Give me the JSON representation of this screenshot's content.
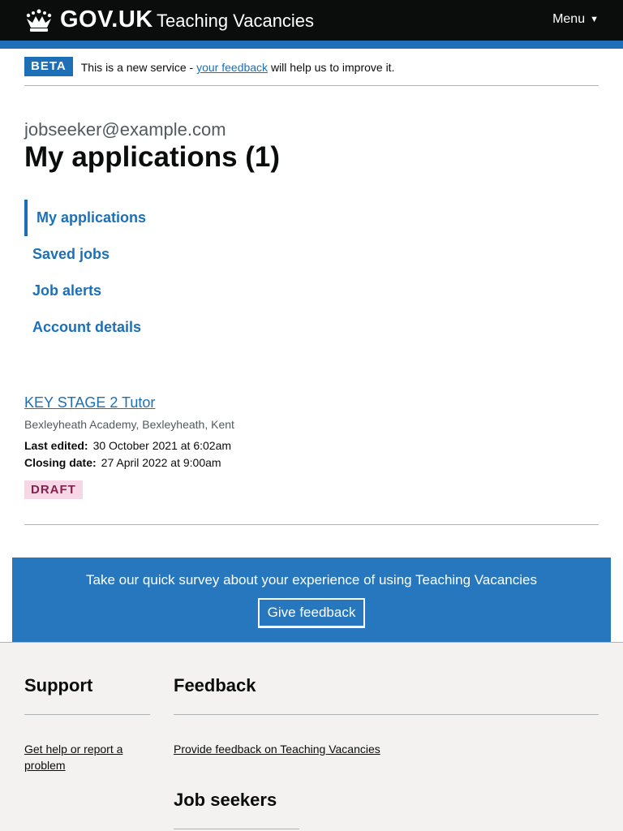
{
  "header": {
    "logo_text": "GOV.UK",
    "service_name": "Teaching Vacancies",
    "menu_label": "Menu",
    "menu_icon": "caret-down-icon"
  },
  "phase_banner": {
    "tag": "BETA",
    "text_before": "This is a new service - ",
    "link_text": "your feedback",
    "text_after": " will help us to improve it."
  },
  "page": {
    "caption": "jobseeker@example.com",
    "title": "My applications (1)"
  },
  "subnav": {
    "items": [
      {
        "label": "My applications",
        "active": true
      },
      {
        "label": "Saved jobs",
        "active": false
      },
      {
        "label": "Job alerts",
        "active": false
      },
      {
        "label": "Account details",
        "active": false
      }
    ]
  },
  "applications": [
    {
      "title": "KEY STAGE 2 Tutor",
      "location": "Bexleyheath Academy, Bexleyheath, Kent",
      "last_edited_label": "Last edited:",
      "last_edited_value": "30 October 2021 at 6:02am",
      "closing_date_label": "Closing date:",
      "closing_date_value": "27 April 2022 at 9:00am",
      "status": "DRAFT"
    }
  ],
  "survey": {
    "text": "Take our quick survey about your experience of using Teaching Vacancies",
    "button_label": "Give feedback"
  },
  "footer": {
    "support": {
      "heading": "Support",
      "link": "Get help or report a problem"
    },
    "feedback": {
      "heading": "Feedback",
      "link": "Provide feedback on Teaching Vacancies"
    },
    "job_seekers": {
      "heading": "Job seekers"
    }
  },
  "colors": {
    "brand_blue": "#1d70b8",
    "header_black": "#0b0c0c",
    "draft_bg": "#f7d7e6",
    "draft_text": "#80224d",
    "survey_bg": "#2677bd",
    "footer_bg": "#f3f2f1"
  }
}
